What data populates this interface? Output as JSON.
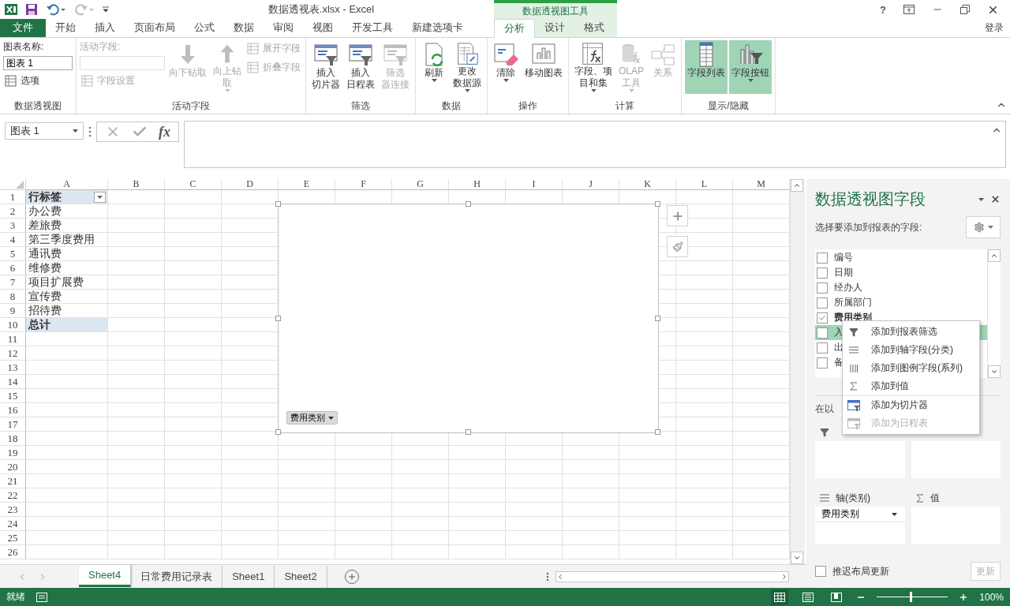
{
  "window": {
    "title": "数据透视表.xlsx - Excel",
    "context_group": "数据透视图工具",
    "help": "?",
    "sign_in": "登录"
  },
  "tabs": [
    {
      "label": "文件",
      "kind": "file",
      "selected": false
    },
    {
      "label": "开始",
      "kind": "main",
      "selected": false
    },
    {
      "label": "插入",
      "kind": "main",
      "selected": false
    },
    {
      "label": "页面布局",
      "kind": "main",
      "selected": false
    },
    {
      "label": "公式",
      "kind": "main",
      "selected": false
    },
    {
      "label": "数据",
      "kind": "main",
      "selected": false
    },
    {
      "label": "审阅",
      "kind": "main",
      "selected": false
    },
    {
      "label": "视图",
      "kind": "main",
      "selected": false
    },
    {
      "label": "开发工具",
      "kind": "main",
      "selected": false
    },
    {
      "label": "新建选项卡",
      "kind": "main",
      "selected": false
    },
    {
      "label": "分析",
      "kind": "context",
      "selected": true
    },
    {
      "label": "设计",
      "kind": "context",
      "selected": false
    },
    {
      "label": "格式",
      "kind": "context",
      "selected": false
    }
  ],
  "ribbon": [
    {
      "label": "数据透视图",
      "columns": [
        [
          {
            "kind": "label",
            "label": "图表名称:",
            "disabled": false
          },
          {
            "kind": "field",
            "value": "图表 1",
            "disabled": false
          },
          {
            "kind": "small",
            "label": "选项",
            "disabled": false
          }
        ]
      ]
    },
    {
      "label": "活动字段",
      "columns": [
        [
          {
            "kind": "label",
            "label": "活动字段:",
            "disabled": true
          },
          {
            "kind": "field",
            "disabled": true
          },
          {
            "kind": "small",
            "label": "字段设置",
            "disabled": true
          }
        ],
        [
          {
            "kind": "large",
            "lines": [
              "向下钻取"
            ],
            "disabled": true,
            "dropdown": false,
            "selected": false
          }
        ],
        [
          {
            "kind": "large",
            "lines": [
              "向上钻",
              "取"
            ],
            "disabled": true,
            "dropdown": true,
            "selected": false
          }
        ],
        [
          {
            "kind": "small",
            "label": "展开字段",
            "disabled": true
          },
          {
            "kind": "small",
            "label": "折叠字段",
            "disabled": true
          }
        ]
      ]
    },
    {
      "label": "筛选",
      "columns": [
        [
          {
            "kind": "large",
            "lines": [
              "插入",
              "切片器"
            ],
            "disabled": false,
            "dropdown": false,
            "selected": false
          }
        ],
        [
          {
            "kind": "large",
            "lines": [
              "插入",
              "日程表"
            ],
            "disabled": false,
            "dropdown": false,
            "selected": false
          }
        ],
        [
          {
            "kind": "large",
            "lines": [
              "筛选",
              "器连接"
            ],
            "disabled": true,
            "dropdown": false,
            "selected": false
          }
        ]
      ]
    },
    {
      "label": "数据",
      "columns": [
        [
          {
            "kind": "large",
            "lines": [
              "刷新"
            ],
            "disabled": false,
            "dropdown": true,
            "selected": false
          }
        ],
        [
          {
            "kind": "large",
            "lines": [
              "更改",
              "数据源"
            ],
            "disabled": false,
            "dropdown": true,
            "selected": false
          }
        ]
      ]
    },
    {
      "label": "操作",
      "columns": [
        [
          {
            "kind": "large",
            "lines": [
              "清除"
            ],
            "disabled": false,
            "dropdown": true,
            "selected": false
          }
        ],
        [
          {
            "kind": "large",
            "lines": [
              "移动图表"
            ],
            "disabled": false,
            "dropdown": false,
            "selected": false
          }
        ]
      ]
    },
    {
      "label": "计算",
      "columns": [
        [
          {
            "kind": "large",
            "lines": [
              "字段、项",
              "目和集"
            ],
            "disabled": false,
            "dropdown": true,
            "selected": false
          }
        ],
        [
          {
            "kind": "large",
            "lines": [
              "OLAP",
              "工具"
            ],
            "disabled": true,
            "dropdown": true,
            "selected": false
          }
        ],
        [
          {
            "kind": "large",
            "lines": [
              "关系"
            ],
            "disabled": true,
            "dropdown": false,
            "selected": false
          }
        ]
      ]
    },
    {
      "label": "显示/隐藏",
      "columns": [
        [
          {
            "kind": "large",
            "lines": [
              "字段列表"
            ],
            "disabled": false,
            "dropdown": false,
            "selected": true
          }
        ],
        [
          {
            "kind": "large",
            "lines": [
              "字段按钮"
            ],
            "disabled": false,
            "dropdown": true,
            "selected": true
          }
        ]
      ]
    }
  ],
  "formula_bar": {
    "name_box": "图表 1",
    "fx": "fx"
  },
  "sheet": {
    "columns": [
      "A",
      "B",
      "C",
      "D",
      "E",
      "F",
      "G",
      "H",
      "I",
      "J",
      "K",
      "L",
      "M"
    ],
    "rows": [
      "1",
      "2",
      "3",
      "4",
      "5",
      "6",
      "7",
      "8",
      "9",
      "10",
      "11",
      "12",
      "13",
      "14",
      "15",
      "16",
      "17",
      "18",
      "19",
      "20",
      "21",
      "22",
      "23",
      "24",
      "25",
      "26"
    ],
    "pivot_cells": [
      {
        "text": "行标签",
        "kind": "header"
      },
      {
        "text": "办公费",
        "kind": "item"
      },
      {
        "text": "差旅费",
        "kind": "item"
      },
      {
        "text": "第三季度费用",
        "kind": "item"
      },
      {
        "text": "通讯费",
        "kind": "item"
      },
      {
        "text": "维修费",
        "kind": "item"
      },
      {
        "text": "项目扩展费",
        "kind": "item"
      },
      {
        "text": "宣传费",
        "kind": "item"
      },
      {
        "text": "招待费",
        "kind": "item"
      },
      {
        "text": "总计",
        "kind": "total"
      }
    ],
    "chart": {
      "field_button": "费用类别"
    }
  },
  "sheet_tabs": [
    {
      "label": "Sheet4",
      "selected": true
    },
    {
      "label": "日常费用记录表",
      "selected": false
    },
    {
      "label": "Sheet1",
      "selected": false
    },
    {
      "label": "Sheet2",
      "selected": false
    }
  ],
  "field_pane": {
    "title": "数据透视图字段",
    "subtitle": "选择要添加到报表的字段:",
    "fields": [
      {
        "label": "编号",
        "checked": false,
        "selected": false
      },
      {
        "label": "日期",
        "checked": false,
        "selected": false
      },
      {
        "label": "经办人",
        "checked": false,
        "selected": false
      },
      {
        "label": "所属部门",
        "checked": false,
        "selected": false
      },
      {
        "label": "费用类别",
        "checked": true,
        "selected": false
      },
      {
        "label": "入",
        "checked": false,
        "selected": true
      },
      {
        "label": "出",
        "checked": false,
        "selected": false
      },
      {
        "label": "备",
        "checked": false,
        "selected": false
      }
    ],
    "context_menu": [
      {
        "label": "添加到报表筛选",
        "disabled": false,
        "separator_above": false
      },
      {
        "label": "添加到轴字段(分类)",
        "disabled": false,
        "separator_above": false
      },
      {
        "label": "添加到图例字段(系列)",
        "disabled": false,
        "separator_above": false
      },
      {
        "label": "添加到值",
        "disabled": false,
        "separator_above": false
      },
      {
        "label": "添加为切片器",
        "disabled": false,
        "separator_above": true
      },
      {
        "label": "添加为日程表",
        "disabled": true,
        "separator_above": false
      }
    ],
    "areas_hint": "在以",
    "areas": [
      {
        "kind": "filters"
      },
      {
        "kind": "legend"
      },
      {
        "kind": "axis",
        "label": "轴(类别)",
        "fields": [
          "费用类别"
        ]
      },
      {
        "kind": "values",
        "label": "值"
      }
    ],
    "defer_update": {
      "label": "推迟布局更新",
      "checked": false
    },
    "update_button": {
      "label": "更新",
      "disabled": true
    }
  },
  "status_bar": {
    "status": "就绪",
    "views": [
      {
        "selected": true
      },
      {
        "selected": false
      },
      {
        "selected": false
      }
    ],
    "level": 0.48,
    "zoom": "100%"
  }
}
